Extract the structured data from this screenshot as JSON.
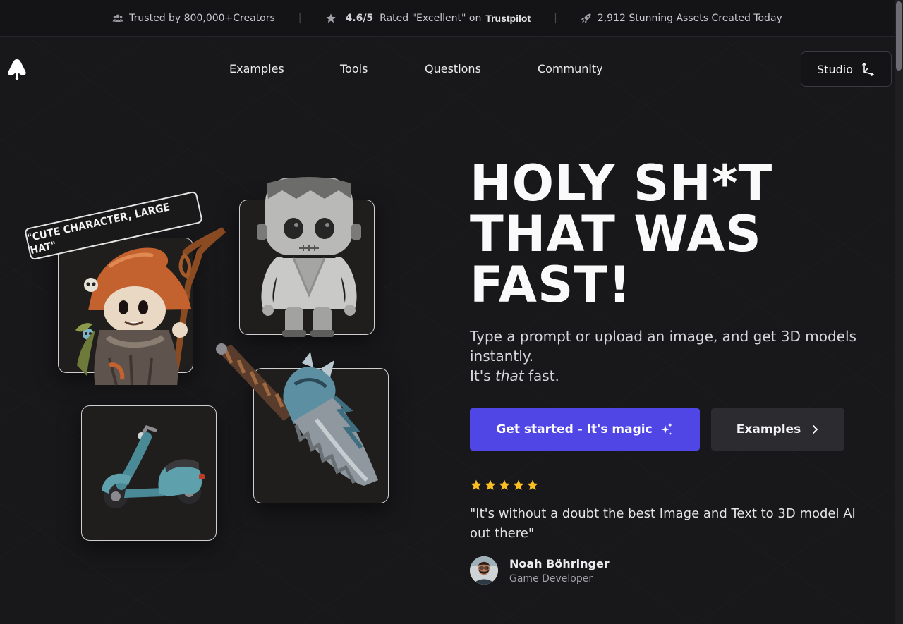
{
  "colors": {
    "background": "#18181b",
    "primary": "#4f46e5",
    "star": "#fbbf24"
  },
  "topbar": {
    "trusted_text": "Trusted by 800,000+Creators",
    "rating_value": "4.6/5",
    "rating_text": "Rated \"Excellent\" on",
    "rating_source": "Trustpilot",
    "assets_text": "2,912 Stunning Assets Created Today",
    "separator": "|"
  },
  "nav": {
    "links": [
      {
        "label": "Examples"
      },
      {
        "label": "Tools"
      },
      {
        "label": "Questions"
      },
      {
        "label": "Community"
      }
    ],
    "studio_label": "Studio"
  },
  "showcase": {
    "prompt_tag": "\"CUTE CHARACTER, LARGE HAT\"",
    "models": [
      "wizard-character",
      "frankenstein-figure",
      "scooter",
      "dragon-blade"
    ]
  },
  "hero": {
    "title_lines": [
      "HOLY SH*T",
      "THAT WAS",
      "FAST!"
    ],
    "subtitle_line1": "Type a prompt or upload an image, and get 3D models instantly.",
    "subtitle_prefix": "It's ",
    "subtitle_em": "that",
    "subtitle_suffix": " fast.",
    "primary_cta": "Get started - It's magic",
    "secondary_cta": "Examples"
  },
  "review": {
    "stars": 5,
    "quote": "\"It's without a doubt the best Image and Text to 3D model AI out there\"",
    "author_name": "Noah Böhringer",
    "author_role": "Game Developer"
  }
}
